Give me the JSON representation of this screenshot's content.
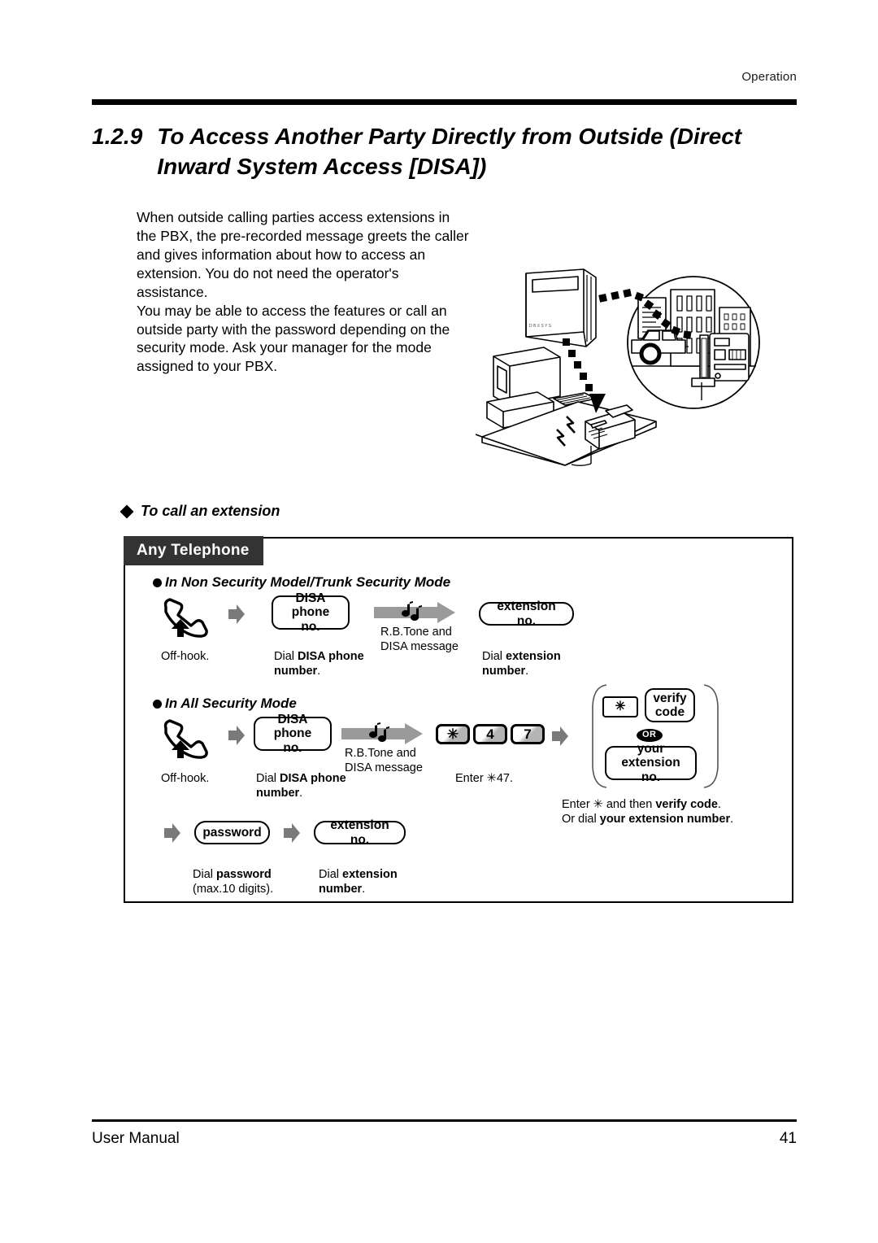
{
  "header": {
    "section_label": "Operation"
  },
  "title": {
    "number": "1.2.9",
    "text": "To Access Another Party Directly from Outside (Direct Inward System Access [DISA])"
  },
  "intro": {
    "paragraph1": "When outside calling parties access extensions in the PBX, the pre-recorded message greets the caller and gives information about how to access an extension. You do not need the operator's assistance.",
    "paragraph2": "You may be able to access the features or call an outside party with the password depending on the security mode. Ask your manager for the mode assigned to your PBX."
  },
  "section": {
    "heading": "To call an extension"
  },
  "panel": {
    "tab_label": "Any Telephone",
    "mode1": {
      "heading": "In Non Security Model/Trunk Security Mode",
      "steps": {
        "offhook_caption": "Off-hook.",
        "disa_token_line1": "DISA",
        "disa_token_line2": "phone no.",
        "disa_caption_plain": "Dial ",
        "disa_caption_bold": "DISA phone number",
        "disa_caption_end": ".",
        "tone_label_line1": "R.B.Tone and",
        "tone_label_line2": "DISA message",
        "ext_token": "extension no.",
        "ext_caption_plain": "Dial ",
        "ext_caption_bold": "extension number",
        "ext_caption_end": "."
      }
    },
    "mode2": {
      "heading": "In All Security Mode",
      "steps": {
        "offhook_caption": "Off-hook.",
        "disa_token_line1": "DISA",
        "disa_token_line2": "phone no.",
        "disa_caption_plain": "Dial ",
        "disa_caption_bold": "DISA phone number",
        "disa_caption_end": ".",
        "tone_label_line1": "R.B.Tone and",
        "tone_label_line2": "DISA message",
        "key1": "✳",
        "key2": "4",
        "key3": "7",
        "keys_caption": "Enter ✳47.",
        "verify_line1": "verify",
        "verify_line2": "code",
        "star_key": "✳",
        "or_label": "OR",
        "your_ext_line1": "your",
        "your_ext_line2": "extension no.",
        "verify_caption_a1": "Enter ✳ and then ",
        "verify_caption_a2": "verify code",
        "verify_caption_a3": ".",
        "verify_caption_b1": "Or dial ",
        "verify_caption_b2": "your extension number",
        "verify_caption_b3": ".",
        "password_token": "password",
        "password_caption_plain": "Dial ",
        "password_caption_bold": "password",
        "password_caption_line2": "(max.10 digits).",
        "ext_token": "extension no.",
        "ext_caption_plain": "Dial ",
        "ext_caption_bold": "extension number",
        "ext_caption_end": "."
      }
    }
  },
  "footer": {
    "left": "User Manual",
    "page": "41"
  }
}
